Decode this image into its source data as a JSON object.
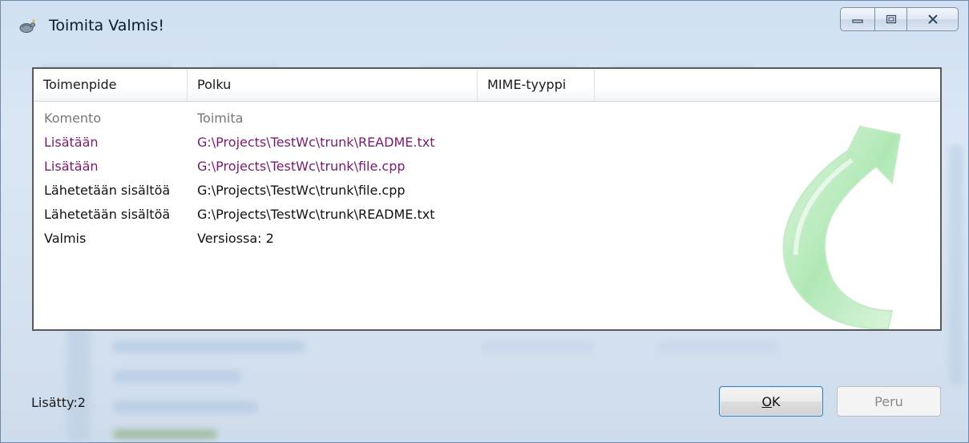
{
  "window": {
    "title": "Toimita Valmis!"
  },
  "list": {
    "columns": [
      "Toimenpide",
      "Polku",
      "MIME-tyyppi"
    ],
    "rows": [
      {
        "action": "Komento",
        "path": "Toimita",
        "style": "gray"
      },
      {
        "action": "Lisätään",
        "path": "G:\\Projects\\TestWc\\trunk\\README.txt",
        "style": "purple"
      },
      {
        "action": "Lisätään",
        "path": "G:\\Projects\\TestWc\\trunk\\file.cpp",
        "style": "purple"
      },
      {
        "action": "Lähetetään sisältöä",
        "path": "G:\\Projects\\TestWc\\trunk\\file.cpp",
        "style": "black"
      },
      {
        "action": "Lähetetään sisältöä",
        "path": "G:\\Projects\\TestWc\\trunk\\README.txt",
        "style": "black"
      },
      {
        "action": "Valmis",
        "path": "Versiossa: 2",
        "style": "black"
      }
    ]
  },
  "status": {
    "text": "Lisätty:2"
  },
  "buttons": {
    "ok_mnemonic": "O",
    "ok_rest": "K",
    "cancel": "Peru"
  },
  "colors": {
    "added": "#7a1a6f",
    "command": "#777777",
    "arrow": "#9be3a4"
  },
  "icons": {
    "window_icon": "tortoise-icon",
    "decoration": "commit-arrow-icon"
  }
}
